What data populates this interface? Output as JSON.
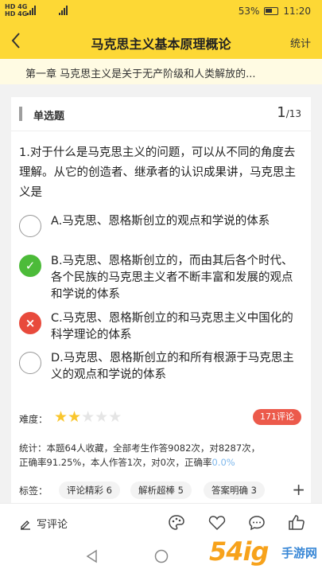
{
  "status_bar": {
    "left_line1": "HD 4G",
    "left_line2": "HD 4G",
    "battery": "53%",
    "time": "11:20"
  },
  "header": {
    "back_icon": "chevron-left-icon",
    "title": "马克思主义基本原理概论",
    "stats_label": "统计"
  },
  "chapter": "第一章 马克思主义是关于无产阶级和人类解放的...",
  "question_card": {
    "type": "单选题",
    "current": "1",
    "total": "/13",
    "question": "1.对于什么是马克思主义的问题，可以从不同的角度去理解。从它的创造者、继承者的认识成果讲，马克思主义是",
    "options": [
      {
        "text": "A.马克思、恩格斯创立的观点和学说的体系",
        "state": "none",
        "mark": ""
      },
      {
        "text": "B.马克思、恩格斯创立的，而由其后各个时代、各个民族的马克思主义者不断丰富和发展的观点和学说的体系",
        "state": "correct",
        "mark": "✓"
      },
      {
        "text": "C.马克思、恩格斯创立的和马克思主义中国化的科学理论的体系",
        "state": "wrong",
        "mark": "×"
      },
      {
        "text": "D.马克思、恩格斯创立的和所有根源于马克思主义的观点和学说的体系",
        "state": "none",
        "mark": ""
      }
    ],
    "difficulty_label": "难度：",
    "difficulty_stars": 2,
    "difficulty_max": 5,
    "comment_count": "171评论",
    "stats_line1": "统计：本题64人收藏，全部考生作答9082次，对8287次，",
    "stats_line2_prefix": "正确率91.25%，本人作答1次，对0次，正确率",
    "stats_rate": "0.0%",
    "tags_label": "标签：",
    "tags": [
      "评论精彩 6",
      "解析超棒 5",
      "答案明确 3"
    ],
    "add_tag_icon": "plus-icon"
  },
  "bottom_bar": {
    "write_comment": "写评论",
    "icons": [
      "palette-icon",
      "heart-icon",
      "comment-icon",
      "thumbs-up-icon"
    ]
  },
  "watermark": {
    "number": "54ig",
    "text": "手游网"
  },
  "colors": {
    "header": "#fdd835",
    "correct": "#4cbb39",
    "wrong": "#e84a3c",
    "badge": "#ec5a4b",
    "star": "#f9c62d",
    "rate": "#7fb8ec"
  }
}
